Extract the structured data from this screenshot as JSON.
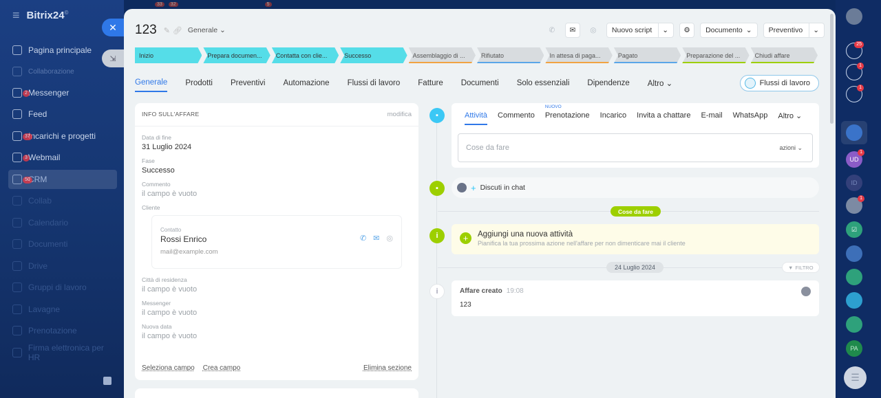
{
  "sidebar": {
    "brand": "Bitrix24",
    "brand_sup": "©",
    "items": [
      {
        "label": "Pagina principale",
        "count": ""
      },
      {
        "label": "Collaborazione",
        "count": ""
      },
      {
        "label": "Messenger",
        "count": "2"
      },
      {
        "label": "Feed",
        "count": ""
      },
      {
        "label": "Incarichi e progetti",
        "count": "37"
      },
      {
        "label": "Webmail",
        "count": "3"
      },
      {
        "label": "CRM",
        "count": "50"
      },
      {
        "label": "Collab",
        "count": ""
      },
      {
        "label": "Calendario",
        "count": ""
      },
      {
        "label": "Documenti",
        "count": ""
      },
      {
        "label": "Drive",
        "count": ""
      },
      {
        "label": "Gruppi di lavoro",
        "count": ""
      },
      {
        "label": "Lavagne",
        "count": ""
      },
      {
        "label": "Prenotazione",
        "count": ""
      },
      {
        "label": "Firma elettronica per HR",
        "count": ""
      }
    ]
  },
  "topbar": {
    "counts": [
      "33",
      "32",
      "5"
    ]
  },
  "deal": {
    "title": "123",
    "category": "Generale",
    "header_buttons": {
      "script": "Nuovo script",
      "document": "Documento",
      "quote": "Preventivo"
    }
  },
  "stages": [
    {
      "label": "Inizio",
      "state": "done",
      "bar": ""
    },
    {
      "label": "Prepara documen...",
      "state": "done",
      "bar": ""
    },
    {
      "label": "Contatta con clie...",
      "state": "done",
      "bar": ""
    },
    {
      "label": "Successo",
      "state": "done",
      "bar": ""
    },
    {
      "label": "Assemblaggio di ...",
      "state": "todo",
      "bar": "#f1a342"
    },
    {
      "label": "Rifiutato",
      "state": "todo",
      "bar": "#5aa6e8"
    },
    {
      "label": "In attesa di paga...",
      "state": "todo",
      "bar": "#f1a342"
    },
    {
      "label": "Pagato",
      "state": "todo",
      "bar": "#5aa6e8"
    },
    {
      "label": "Preparazione del ...",
      "state": "todo",
      "bar": "#9dcf00"
    },
    {
      "label": "Chiudi affare",
      "state": "todo",
      "bar": "#9dcf00"
    }
  ],
  "tabs": [
    "Generale",
    "Prodotti",
    "Preventivi",
    "Automazione",
    "Flussi di lavoro",
    "Fatture",
    "Documenti",
    "Solo essenziali",
    "Dipendenze",
    "Altro"
  ],
  "workflow_button": "Flussi di lavoro",
  "info": {
    "title": "INFO SULL'AFFARE",
    "edit": "modifica",
    "end_date_label": "Data di fine",
    "end_date": "31 Luglio 2024",
    "stage_label": "Fase",
    "stage": "Successo",
    "comment_label": "Commento",
    "comment": "il campo è vuoto",
    "client_label": "Cliente",
    "contact_label": "Contatto",
    "contact_name": "Rossi Enrico",
    "contact_email": "mail@example.com",
    "city_label": "Città di residenza",
    "city": "il campo è vuoto",
    "messenger_label": "Messenger",
    "messenger": "il campo è vuoto",
    "new_date_label": "Nuova data",
    "new_date": "il campo è vuoto",
    "select_field": "Seleziona campo",
    "create_field": "Crea campo",
    "delete_section": "Elimina sezione"
  },
  "activity": {
    "tabs": [
      "Attività",
      "Commento",
      "Prenotazione",
      "Incarico",
      "Invita a chattare",
      "E-mail",
      "WhatsApp",
      "Altro"
    ],
    "new_tag": "NUOVO",
    "placeholder": "Cose da fare",
    "actions": "azioni"
  },
  "chat": {
    "label": "Discuti in chat"
  },
  "todo_pill": "Cose da fare",
  "add_activity": {
    "title": "Aggiungi una nuova attività",
    "subtitle": "Pianifica la tua prossima azione nell'affare per non dimenticare mai il cliente"
  },
  "date_pill": "24 Luglio 2024",
  "filter": "FILTRO",
  "created": {
    "title": "Affare creato",
    "time": "19:08",
    "value": "123"
  },
  "right_sidebar": {
    "badges": [
      "25",
      "1",
      "1",
      "1",
      "1"
    ],
    "avatar_initials": "UD",
    "avatar2_initials": "ID",
    "pa_initials": "PA"
  }
}
